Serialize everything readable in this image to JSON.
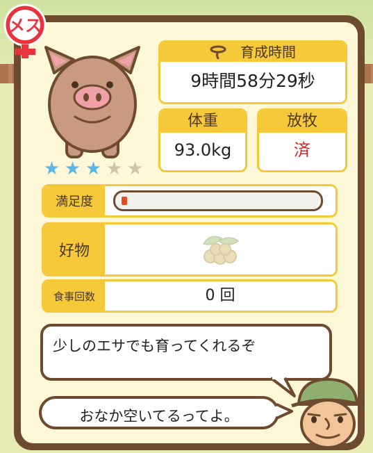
{
  "profile": {
    "sex_badge": "メス",
    "sex_icon": "female-symbol-icon",
    "stars": {
      "filled": 3,
      "total": 5,
      "filled_color": "#5ab6e6",
      "empty_color": "#cfc4a8"
    }
  },
  "stats": {
    "breeding_time": {
      "label": "育成時間",
      "icon": "lasso-icon",
      "value": "9時間58分29秒"
    },
    "weight": {
      "label": "体重",
      "value": "93.0kg"
    },
    "grazing": {
      "label": "放牧",
      "value": "済"
    }
  },
  "satisfaction": {
    "label": "満足度",
    "level": 0.03
  },
  "favorite": {
    "label": "好物",
    "icon": "soybean-icon"
  },
  "meal_count": {
    "label": "食事回数",
    "value": "0 回"
  },
  "messages": {
    "hint": "少しのエサでも育ってくれるぞ",
    "status": "おなか空いてるってよ。"
  },
  "colors": {
    "frame": "#6e4a2f",
    "accent": "#f6c93a",
    "panel": "#fff8d8",
    "badge_red": "#e8343c"
  }
}
